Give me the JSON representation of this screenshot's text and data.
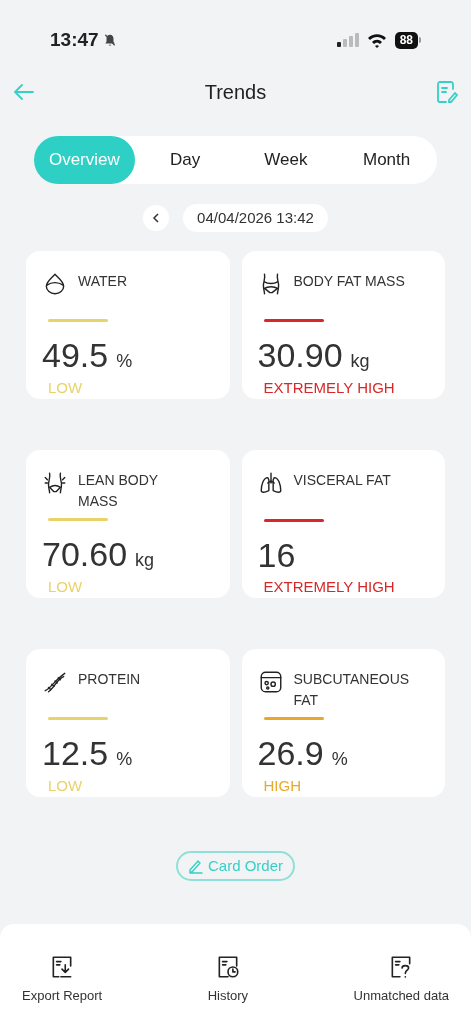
{
  "status_bar": {
    "time": "13:47",
    "battery": "88"
  },
  "header": {
    "title": "Trends"
  },
  "tabs": [
    {
      "label": "Overview",
      "selected": true
    },
    {
      "label": "Day",
      "selected": false
    },
    {
      "label": "Week",
      "selected": false
    },
    {
      "label": "Month",
      "selected": false
    }
  ],
  "date": "04/04/2026 13:42",
  "metrics": [
    {
      "kind": "water",
      "label": "WATER",
      "value": "49.5",
      "unit": "%",
      "status": "LOW",
      "color": "#e8d36a"
    },
    {
      "kind": "fat",
      "label": "BODY FAT MASS",
      "value": "30.90",
      "unit": "kg",
      "status": "EXTREMELY HIGH",
      "color": "#d62828"
    },
    {
      "kind": "lean",
      "label": "LEAN BODY MASS",
      "value": "70.60",
      "unit": "kg",
      "status": "LOW",
      "color": "#e8d36a"
    },
    {
      "kind": "lungs",
      "label": "VISCERAL FAT",
      "value": "16",
      "status": "EXTREMELY HIGH",
      "color": "#d62828"
    },
    {
      "kind": "protein",
      "label": "PROTEIN",
      "value": "12.5",
      "unit": "%",
      "status": "LOW",
      "color": "#e8d36a"
    },
    {
      "kind": "subcutaneous",
      "label": "SUBCUTANEOUS FAT",
      "value": "26.9",
      "unit": "%",
      "status": "HIGH",
      "color": "#e8a92a"
    }
  ],
  "card_order": "Card Order",
  "bottom_actions": [
    {
      "kind": "export",
      "label": "Export Report"
    },
    {
      "kind": "history",
      "label": "History"
    },
    {
      "kind": "unmatched",
      "label": "Unmatched data"
    }
  ]
}
